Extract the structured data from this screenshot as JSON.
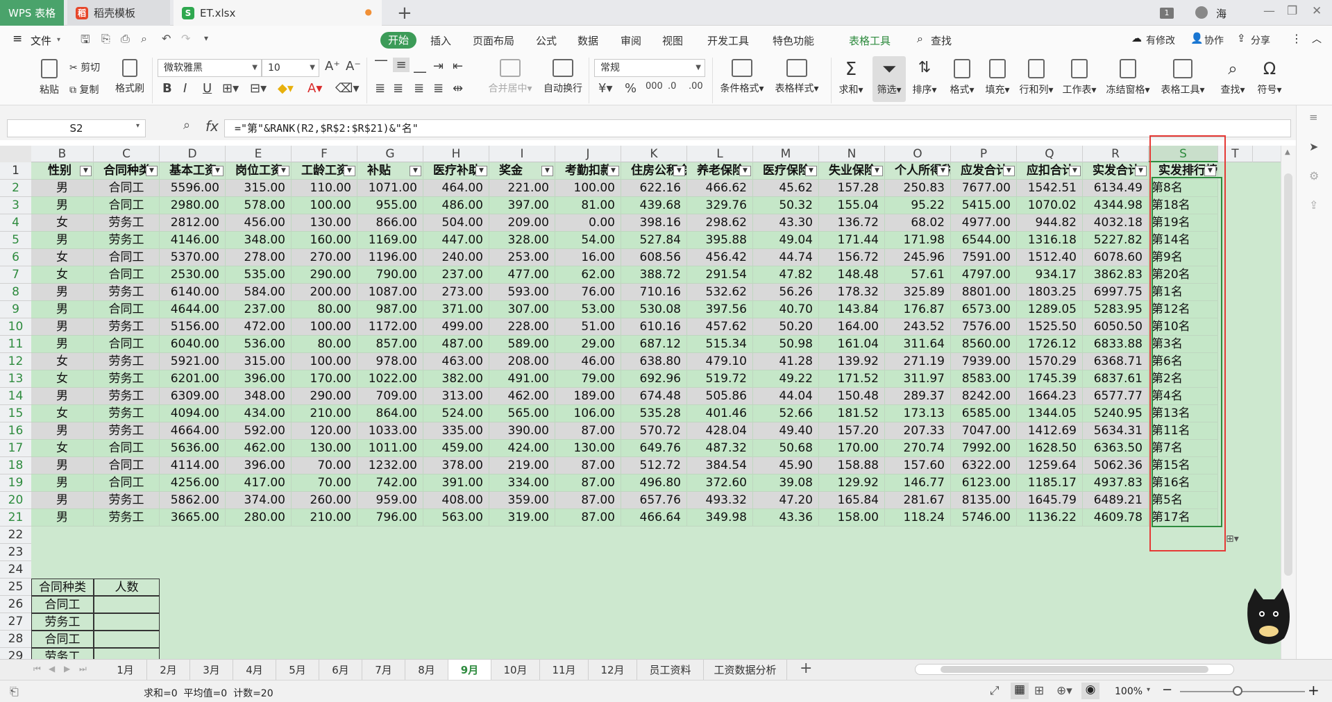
{
  "titlebar": {
    "tabs": [
      {
        "label": "WPS 表格"
      },
      {
        "label": "稻壳模板"
      },
      {
        "label": "ET.xlsx"
      }
    ],
    "badge": "1",
    "user": "海"
  },
  "menu": {
    "file": "文件",
    "tabs": [
      "开始",
      "插入",
      "页面布局",
      "公式",
      "数据",
      "审阅",
      "视图",
      "开发工具",
      "特色功能",
      "表格工具"
    ],
    "search": "查找",
    "modified": "有修改",
    "collab": "协作",
    "share": "分享"
  },
  "ribbon": {
    "paste": "粘贴",
    "cut": "剪切",
    "copy": "复制",
    "format_painter": "格式刷",
    "font": "微软雅黑",
    "size": "10",
    "merge": "合并居中",
    "wrap": "自动换行",
    "numfmt": "常规",
    "cond": "条件格式",
    "tblstyle": "表格样式",
    "sum": "求和",
    "filter": "筛选",
    "sort": "排序",
    "format": "格式",
    "fill": "填充",
    "rowcol": "行和列",
    "sheet": "工作表",
    "freeze": "冻结窗格",
    "tbltool": "表格工具",
    "find": "查找",
    "symbol": "符号"
  },
  "formula_bar": {
    "cell_ref": "S2",
    "fx": "fx",
    "formula": "=\"第\"&RANK(R2,$R$2:$R$21)&\"名\""
  },
  "columns": [
    "B",
    "C",
    "D",
    "E",
    "F",
    "G",
    "H",
    "I",
    "J",
    "K",
    "L",
    "M",
    "N",
    "O",
    "P",
    "Q",
    "R",
    "S",
    "T"
  ],
  "headers": [
    "性别",
    "合同种类",
    "基本工资",
    "岗位工资",
    "工龄工资",
    "补贴",
    "医疗补助",
    "奖金",
    "考勤扣款",
    "住房公积金",
    "养老保险",
    "医疗保险",
    "失业保险",
    "个人所得税",
    "应发合计",
    "应扣合计",
    "实发合计",
    "实发排行榜"
  ],
  "rows": [
    [
      "男",
      "合同工",
      "5596.00",
      "315.00",
      "110.00",
      "1071.00",
      "464.00",
      "221.00",
      "100.00",
      "622.16",
      "466.62",
      "45.62",
      "157.28",
      "250.83",
      "7677.00",
      "1542.51",
      "6134.49",
      "第8名"
    ],
    [
      "男",
      "合同工",
      "2980.00",
      "578.00",
      "100.00",
      "955.00",
      "486.00",
      "397.00",
      "81.00",
      "439.68",
      "329.76",
      "50.32",
      "155.04",
      "95.22",
      "5415.00",
      "1070.02",
      "4344.98",
      "第18名"
    ],
    [
      "女",
      "劳务工",
      "2812.00",
      "456.00",
      "130.00",
      "866.00",
      "504.00",
      "209.00",
      "0.00",
      "398.16",
      "298.62",
      "43.30",
      "136.72",
      "68.02",
      "4977.00",
      "944.82",
      "4032.18",
      "第19名"
    ],
    [
      "男",
      "劳务工",
      "4146.00",
      "348.00",
      "160.00",
      "1169.00",
      "447.00",
      "328.00",
      "54.00",
      "527.84",
      "395.88",
      "49.04",
      "171.44",
      "171.98",
      "6544.00",
      "1316.18",
      "5227.82",
      "第14名"
    ],
    [
      "女",
      "合同工",
      "5370.00",
      "278.00",
      "270.00",
      "1196.00",
      "240.00",
      "253.00",
      "16.00",
      "608.56",
      "456.42",
      "44.74",
      "156.72",
      "245.96",
      "7591.00",
      "1512.40",
      "6078.60",
      "第9名"
    ],
    [
      "女",
      "合同工",
      "2530.00",
      "535.00",
      "290.00",
      "790.00",
      "237.00",
      "477.00",
      "62.00",
      "388.72",
      "291.54",
      "47.82",
      "148.48",
      "57.61",
      "4797.00",
      "934.17",
      "3862.83",
      "第20名"
    ],
    [
      "男",
      "劳务工",
      "6140.00",
      "584.00",
      "200.00",
      "1087.00",
      "273.00",
      "593.00",
      "76.00",
      "710.16",
      "532.62",
      "56.26",
      "178.32",
      "325.89",
      "8801.00",
      "1803.25",
      "6997.75",
      "第1名"
    ],
    [
      "男",
      "合同工",
      "4644.00",
      "237.00",
      "80.00",
      "987.00",
      "371.00",
      "307.00",
      "53.00",
      "530.08",
      "397.56",
      "40.70",
      "143.84",
      "176.87",
      "6573.00",
      "1289.05",
      "5283.95",
      "第12名"
    ],
    [
      "男",
      "劳务工",
      "5156.00",
      "472.00",
      "100.00",
      "1172.00",
      "499.00",
      "228.00",
      "51.00",
      "610.16",
      "457.62",
      "50.20",
      "164.00",
      "243.52",
      "7576.00",
      "1525.50",
      "6050.50",
      "第10名"
    ],
    [
      "男",
      "合同工",
      "6040.00",
      "536.00",
      "80.00",
      "857.00",
      "487.00",
      "589.00",
      "29.00",
      "687.12",
      "515.34",
      "50.98",
      "161.04",
      "311.64",
      "8560.00",
      "1726.12",
      "6833.88",
      "第3名"
    ],
    [
      "女",
      "劳务工",
      "5921.00",
      "315.00",
      "100.00",
      "978.00",
      "463.00",
      "208.00",
      "46.00",
      "638.80",
      "479.10",
      "41.28",
      "139.92",
      "271.19",
      "7939.00",
      "1570.29",
      "6368.71",
      "第6名"
    ],
    [
      "女",
      "劳务工",
      "6201.00",
      "396.00",
      "170.00",
      "1022.00",
      "382.00",
      "491.00",
      "79.00",
      "692.96",
      "519.72",
      "49.22",
      "171.52",
      "311.97",
      "8583.00",
      "1745.39",
      "6837.61",
      "第2名"
    ],
    [
      "男",
      "劳务工",
      "6309.00",
      "348.00",
      "290.00",
      "709.00",
      "313.00",
      "462.00",
      "189.00",
      "674.48",
      "505.86",
      "44.04",
      "150.48",
      "289.37",
      "8242.00",
      "1664.23",
      "6577.77",
      "第4名"
    ],
    [
      "女",
      "劳务工",
      "4094.00",
      "434.00",
      "210.00",
      "864.00",
      "524.00",
      "565.00",
      "106.00",
      "535.28",
      "401.46",
      "52.66",
      "181.52",
      "173.13",
      "6585.00",
      "1344.05",
      "5240.95",
      "第13名"
    ],
    [
      "男",
      "劳务工",
      "4664.00",
      "592.00",
      "120.00",
      "1033.00",
      "335.00",
      "390.00",
      "87.00",
      "570.72",
      "428.04",
      "49.40",
      "157.20",
      "207.33",
      "7047.00",
      "1412.69",
      "5634.31",
      "第11名"
    ],
    [
      "女",
      "合同工",
      "5636.00",
      "462.00",
      "130.00",
      "1011.00",
      "459.00",
      "424.00",
      "130.00",
      "649.76",
      "487.32",
      "50.68",
      "170.00",
      "270.74",
      "7992.00",
      "1628.50",
      "6363.50",
      "第7名"
    ],
    [
      "男",
      "合同工",
      "4114.00",
      "396.00",
      "70.00",
      "1232.00",
      "378.00",
      "219.00",
      "87.00",
      "512.72",
      "384.54",
      "45.90",
      "158.88",
      "157.60",
      "6322.00",
      "1259.64",
      "5062.36",
      "第15名"
    ],
    [
      "男",
      "合同工",
      "4256.00",
      "417.00",
      "70.00",
      "742.00",
      "391.00",
      "334.00",
      "87.00",
      "496.80",
      "372.60",
      "39.08",
      "129.92",
      "146.77",
      "6123.00",
      "1185.17",
      "4937.83",
      "第16名"
    ],
    [
      "男",
      "劳务工",
      "5862.00",
      "374.00",
      "260.00",
      "959.00",
      "408.00",
      "359.00",
      "87.00",
      "657.76",
      "493.32",
      "47.20",
      "165.84",
      "281.67",
      "8135.00",
      "1645.79",
      "6489.21",
      "第5名"
    ],
    [
      "男",
      "劳务工",
      "3665.00",
      "280.00",
      "210.00",
      "796.00",
      "563.00",
      "319.00",
      "87.00",
      "466.64",
      "349.98",
      "43.36",
      "158.00",
      "118.24",
      "5746.00",
      "1136.22",
      "4609.78",
      "第17名"
    ]
  ],
  "row_numbers": [
    "1",
    "2",
    "3",
    "4",
    "5",
    "6",
    "7",
    "8",
    "9",
    "10",
    "11",
    "12",
    "13",
    "14",
    "15",
    "16",
    "17",
    "18",
    "19",
    "20",
    "21",
    "22",
    "23",
    "24",
    "25",
    "26",
    "27",
    "28",
    "29"
  ],
  "small_table": {
    "headers": [
      "合同种类",
      "人数"
    ],
    "rows": [
      "合同工",
      "劳务工",
      "合同工",
      "劳务工"
    ]
  },
  "sheets": [
    "1月",
    "2月",
    "3月",
    "4月",
    "5月",
    "6月",
    "7月",
    "8月",
    "9月",
    "10月",
    "11月",
    "12月",
    "员工资料",
    "工资数据分析"
  ],
  "active_sheet": "9月",
  "status": {
    "text": "求和=0  平均值=0  计数=20",
    "zoom": "100%"
  },
  "colors": {
    "accent": "#3c9b58",
    "grid_bg": "#cde8cf",
    "selection": "#e53935"
  }
}
